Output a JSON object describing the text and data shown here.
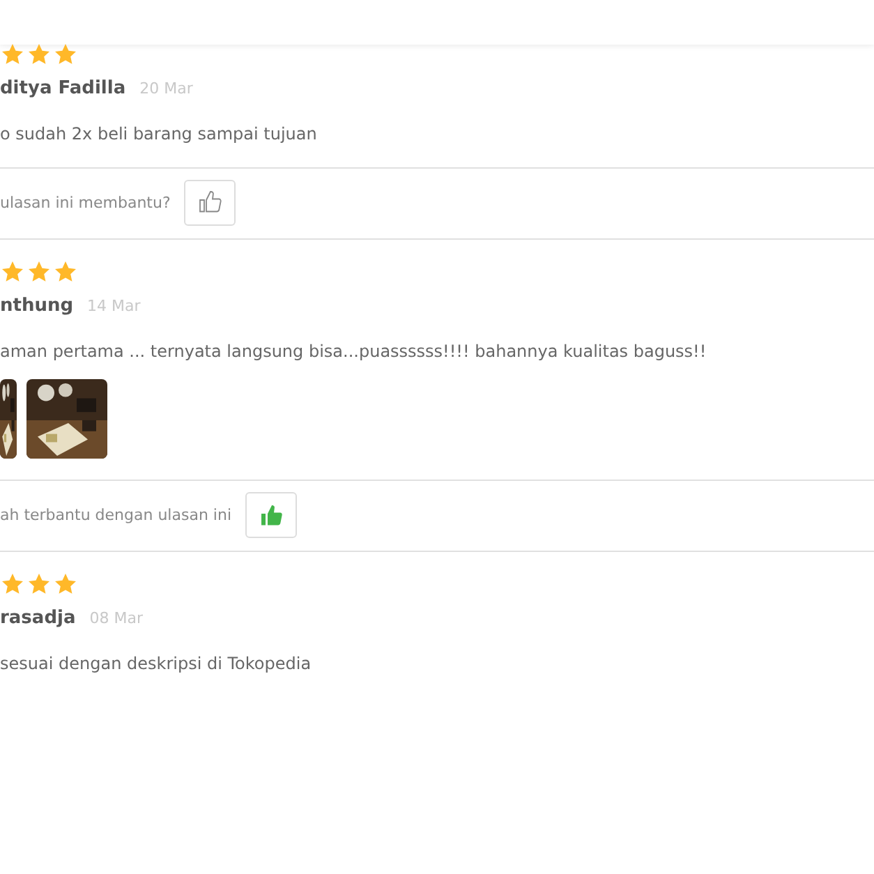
{
  "reviews": [
    {
      "stars": 3,
      "name": "ditya Fadilla",
      "date": "20 Mar",
      "text": "o sudah 2x beli barang sampai tujuan",
      "helpful": {
        "text": "ulasan ini membantu?",
        "liked": false
      }
    },
    {
      "stars": 3,
      "name": "nthung",
      "date": "14 Mar",
      "text": "aman pertama ... ternyata langsung bisa...puassssss!!!! bahannya kualitas baguss!!",
      "photos": [
        {
          "kind": "picture"
        },
        {
          "kind": "picture"
        }
      ],
      "helpful": {
        "text": "ah terbantu dengan ulasan ini",
        "liked": true
      }
    },
    {
      "stars": 3,
      "name": "rasadja",
      "date": "08 Mar",
      "text": " sesuai dengan deskripsi di Tokopedia"
    }
  ]
}
